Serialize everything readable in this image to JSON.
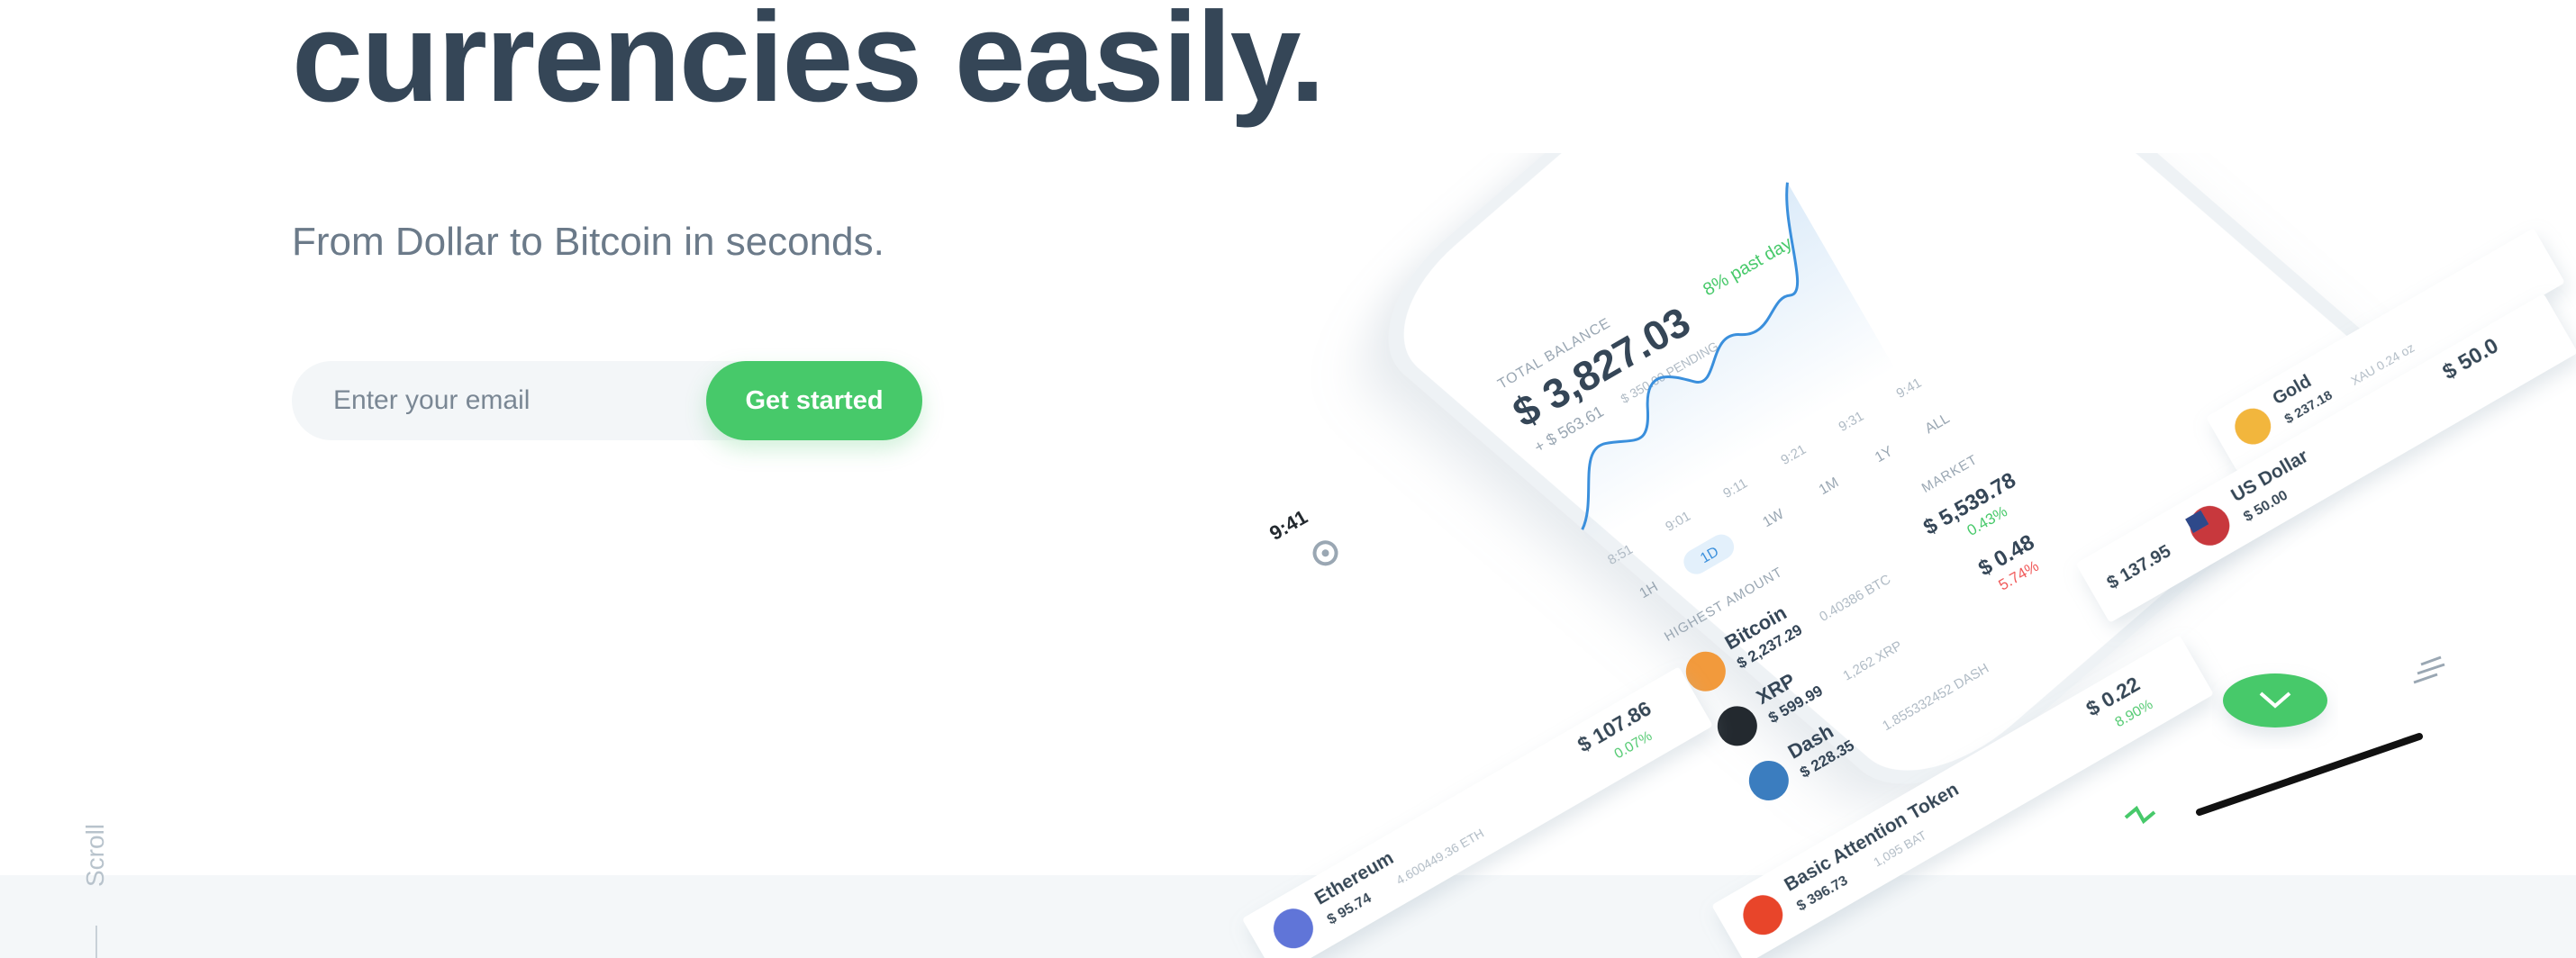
{
  "hero": {
    "headline": "currencies easily.",
    "subhead": "From Dollar to Bitcoin in seconds.",
    "email_placeholder": "Enter your email",
    "cta_label": "Get started"
  },
  "scroll": {
    "label": "Scroll"
  },
  "phone": {
    "time": "9:41",
    "total_balance_label": "TOTAL BALANCE",
    "total_balance": "$ 3,827.03",
    "change_text": "8% past day",
    "change_amount": "+ $ 563.61",
    "pending": "$ 350.00 PENDING",
    "time_ticks": [
      "8:51",
      "9:01",
      "9:11",
      "9:21",
      "9:31",
      "9:41"
    ],
    "ranges": [
      "1H",
      "1D",
      "1W",
      "1M",
      "1Y",
      "ALL"
    ],
    "selected_range": "1D",
    "sort_label": "HIGHEST AMOUNT",
    "market_label": "MARKET",
    "assets": [
      {
        "name": "Bitcoin",
        "amount": "$ 2,237.29",
        "holding": "0.40386 BTC",
        "price": "$ 5,539.78",
        "change": "0.43%",
        "direction": "up",
        "icon_color": "#f29a3c",
        "icon": "bitcoin-icon"
      },
      {
        "name": "XRP",
        "amount": "$ 599.99",
        "holding": "1,262 XRP",
        "price": "$ 0.48",
        "change": "5.74%",
        "direction": "down",
        "icon_color": "#23292f",
        "icon": "xrp-icon"
      },
      {
        "name": "Dash",
        "amount": "$ 228.35",
        "holding": "1.855332452 DASH",
        "price": "$ 137.95",
        "change": "",
        "direction": "",
        "icon_color": "#3b7dbf",
        "icon": "dash-icon"
      }
    ],
    "colors": {
      "accent_green": "#47c96a",
      "negative_red": "#f05a5a",
      "chart_blue": "#3a8fdc",
      "text": "#354657"
    }
  },
  "floating_cards": [
    {
      "name": "Gold",
      "amount": "$ 237.18",
      "holding": "XAU 0.24 oz",
      "price": "$ 50.0",
      "icon_color": "#f2b63c",
      "icon": "gold-icon"
    },
    {
      "name": "US Dollar",
      "amount": "$ 50.00",
      "holding": "",
      "price": "$ 137.95",
      "icon_color": "#c8373c",
      "icon": "us-flag-icon"
    },
    {
      "name": "Ethereum",
      "amount": "$ 95.74",
      "holding": "4.600449.36 ETH",
      "price": "$ 107.86",
      "change": "0.07%",
      "direction": "up",
      "icon_color": "#6175d8",
      "icon": "ethereum-icon"
    },
    {
      "name": "Basic Attention Token",
      "amount": "$ 396.73",
      "holding": "1,095 BAT",
      "price": "$ 0.22",
      "change": "8.90%",
      "direction": "up",
      "icon_color": "#e8452c",
      "icon": "bat-icon"
    }
  ]
}
